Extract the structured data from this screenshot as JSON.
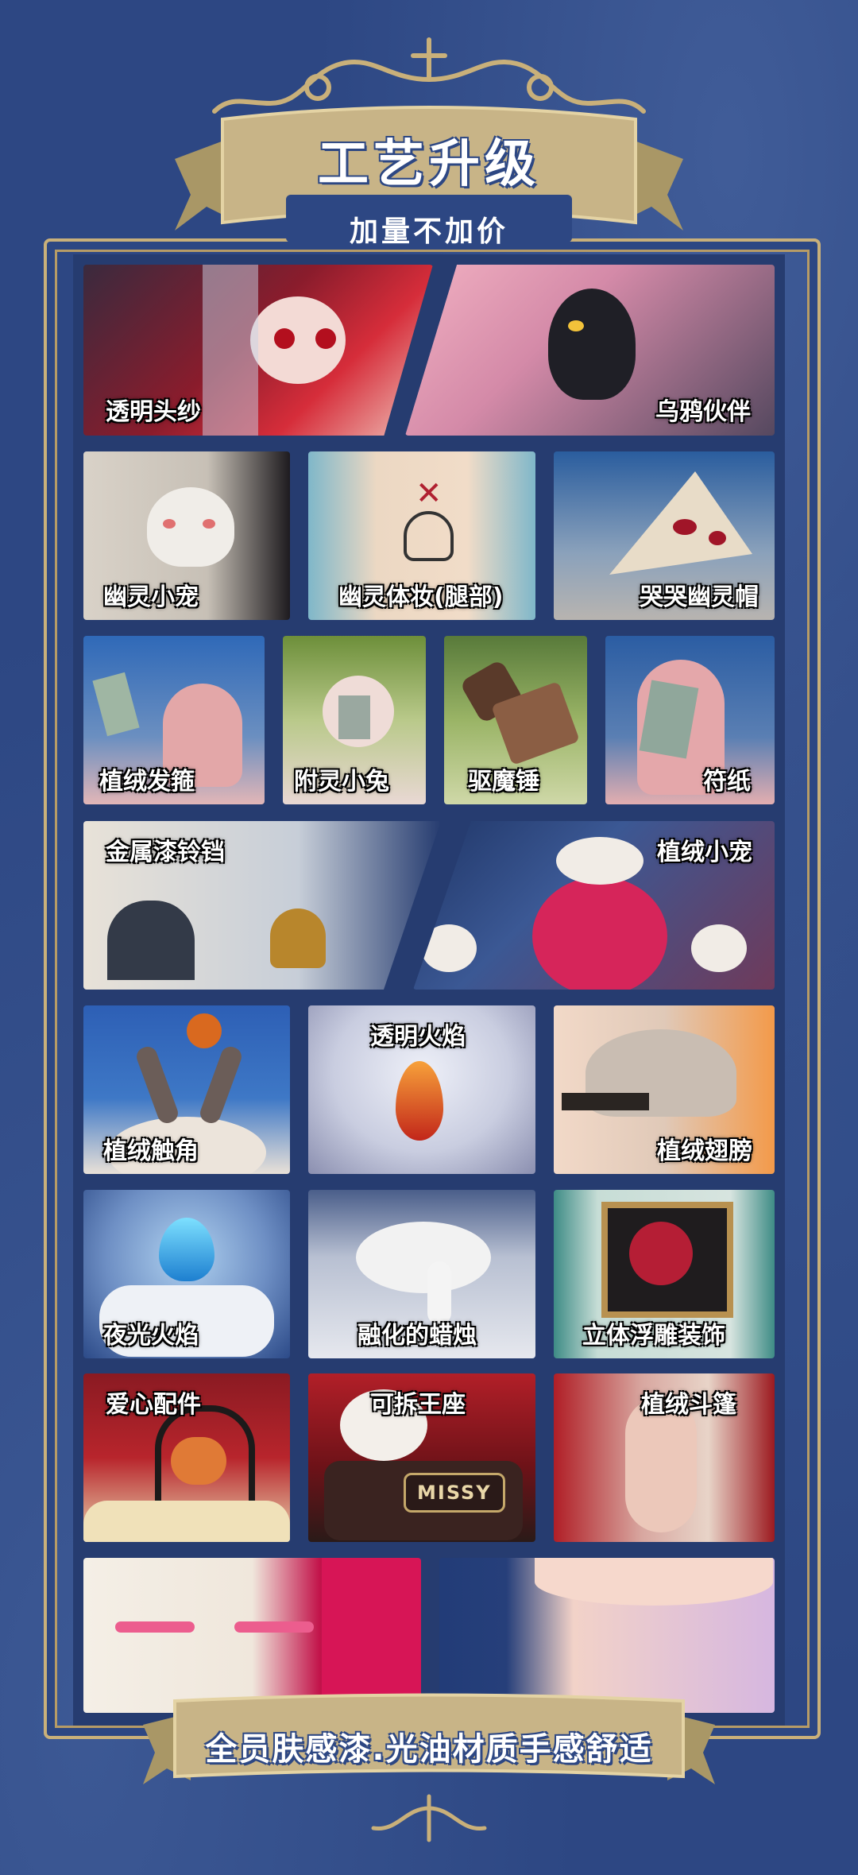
{
  "header": {
    "title": "工艺升级",
    "subtitle": "加量不加价"
  },
  "tiles": [
    {
      "label": "透明头纱"
    },
    {
      "label": "乌鸦伙伴"
    },
    {
      "label": "幽灵小宠"
    },
    {
      "label": "幽灵体妆(腿部)"
    },
    {
      "label": "哭哭幽灵帽"
    },
    {
      "label": "植绒发箍"
    },
    {
      "label": "附灵小兔"
    },
    {
      "label": "驱魔锤"
    },
    {
      "label": "符纸"
    },
    {
      "label": "金属漆铃铛"
    },
    {
      "label": "植绒小宠"
    },
    {
      "label": "植绒触角"
    },
    {
      "label": "透明火焰"
    },
    {
      "label": "植绒翅膀"
    },
    {
      "label": "夜光火焰"
    },
    {
      "label": "融化的蜡烛"
    },
    {
      "label": "立体浮雕装饰"
    },
    {
      "label": "爱心配件"
    },
    {
      "label": "可拆王座"
    },
    {
      "label": "植绒斗篷"
    }
  ],
  "throne_plate": "MISSY",
  "footer": {
    "text": "全员肤感漆.光油材质手感舒适"
  },
  "colors": {
    "background": "#2d4783",
    "gold": "#c9b07a",
    "banner": "#c8b487"
  }
}
